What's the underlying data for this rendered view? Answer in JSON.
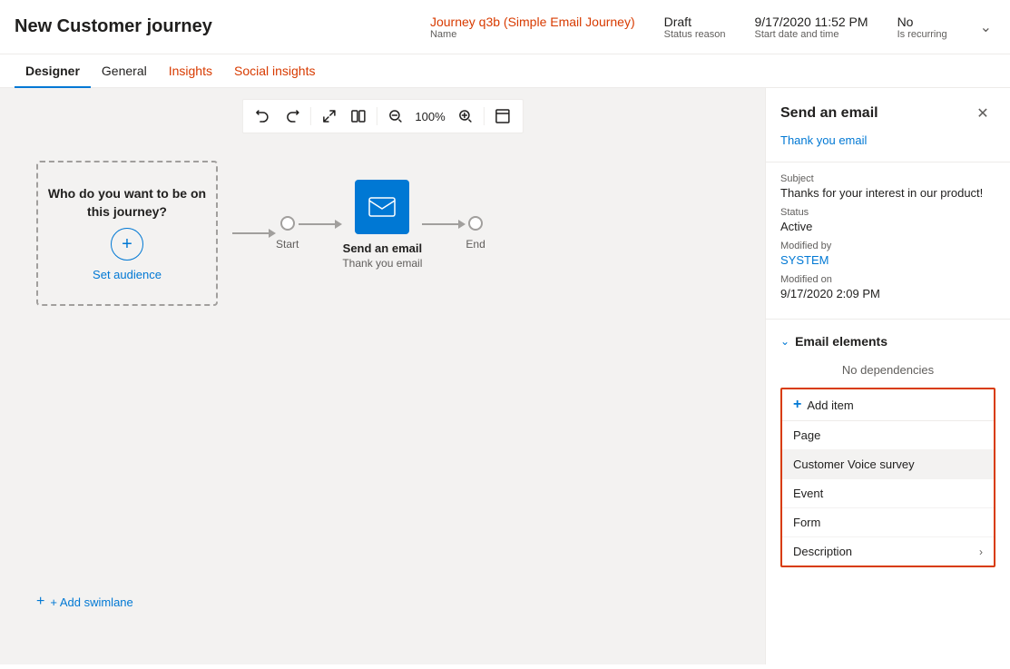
{
  "header": {
    "title": "New Customer journey",
    "meta": {
      "name_value": "Journey q3b (Simple Email Journey)",
      "name_label": "Name",
      "status_value": "Draft",
      "status_label": "Status reason",
      "start_value": "9/17/2020 11:52 PM",
      "start_label": "Start date and time",
      "recurring_value": "No",
      "recurring_label": "Is recurring"
    }
  },
  "tabs": [
    {
      "id": "designer",
      "label": "Designer",
      "active": true
    },
    {
      "id": "general",
      "label": "General",
      "active": false
    },
    {
      "id": "insights",
      "label": "Insights",
      "active": false,
      "orange": true
    },
    {
      "id": "social-insights",
      "label": "Social insights",
      "active": false,
      "orange": true
    }
  ],
  "toolbar": {
    "undo": "↩",
    "redo": "↪",
    "fit": "⤢",
    "split": "⊞",
    "zoom_out": "−",
    "zoom_level": "100%",
    "zoom_in": "+",
    "fullscreen": "⛶"
  },
  "canvas": {
    "audience_text": "Who do you want to be on this journey?",
    "set_audience_label": "Set audience",
    "start_label": "Start",
    "end_label": "End",
    "email_node_name": "Send an email",
    "email_node_sub": "Thank you email",
    "add_swimlane": "+ Add swimlane"
  },
  "panel": {
    "title": "Send an email",
    "link": "Thank you email",
    "close_icon": "✕",
    "fields": [
      {
        "label": "Subject",
        "value": "Thanks for your interest in our product!",
        "is_link": false
      },
      {
        "label": "Status",
        "value": "Active",
        "is_link": false
      },
      {
        "label": "Modified by",
        "value": "SYSTEM",
        "is_link": true
      },
      {
        "label": "Modified on",
        "value": "9/17/2020 2:09 PM",
        "is_link": false
      }
    ],
    "email_elements_title": "Email elements",
    "no_dependencies": "No dependencies",
    "add_item_label": "+ Add item",
    "dropdown_items": [
      {
        "id": "page",
        "label": "Page",
        "selected": false
      },
      {
        "id": "customer-voice-survey",
        "label": "Customer Voice survey",
        "selected": true
      },
      {
        "id": "event",
        "label": "Event",
        "selected": false
      },
      {
        "id": "form",
        "label": "Form",
        "selected": false
      }
    ],
    "description_label": "Description"
  },
  "colors": {
    "accent": "#0078d4",
    "orange": "#d83b01",
    "border_red": "#d83b01"
  }
}
